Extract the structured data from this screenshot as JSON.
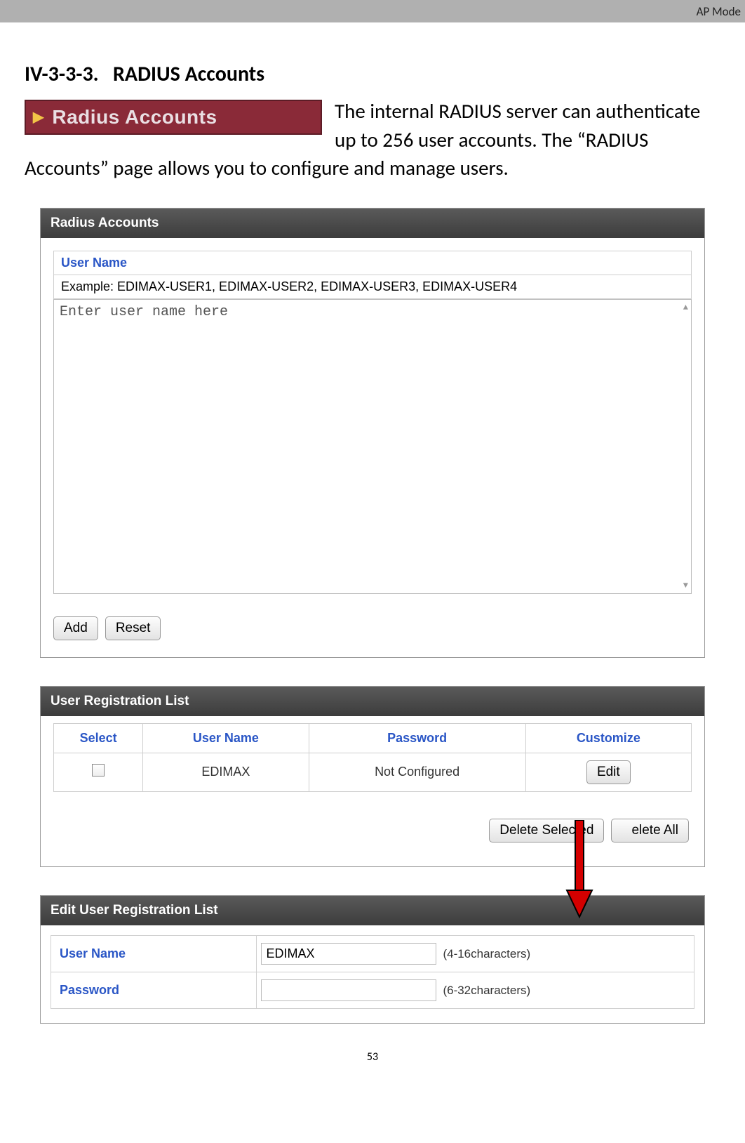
{
  "header": {
    "mode_label": "AP Mode"
  },
  "section": {
    "number": "IV-3-3-3.",
    "title": "RADIUS Accounts",
    "nav_label": "Radius Accounts",
    "intro_text": "The internal RADIUS server can authenticate up to 256 user accounts. The “RADIUS Accounts” page allows you to configure and manage users."
  },
  "radius_panel": {
    "title": "Radius Accounts",
    "user_name_heading": "User Name",
    "example_text": "Example: EDIMAX-USER1, EDIMAX-USER2, EDIMAX-USER3, EDIMAX-USER4",
    "textarea_placeholder": "Enter user name here",
    "add_button": "Add",
    "reset_button": "Reset"
  },
  "reg_list": {
    "title": "User Registration List",
    "columns": {
      "select": "Select",
      "user": "User Name",
      "password": "Password",
      "customize": "Customize"
    },
    "rows": [
      {
        "user": "EDIMAX",
        "password": "Not Configured",
        "edit_label": "Edit"
      }
    ],
    "delete_selected": "Delete Selected",
    "delete_all": "elete All"
  },
  "edit_form": {
    "title": "Edit User Registration List",
    "user_name_label": "User Name",
    "user_name_value": "EDIMAX",
    "user_name_hint": "(4-16characters)",
    "password_label": "Password",
    "password_value": "",
    "password_hint": "(6-32characters)"
  },
  "footer": {
    "page_number": "53"
  }
}
